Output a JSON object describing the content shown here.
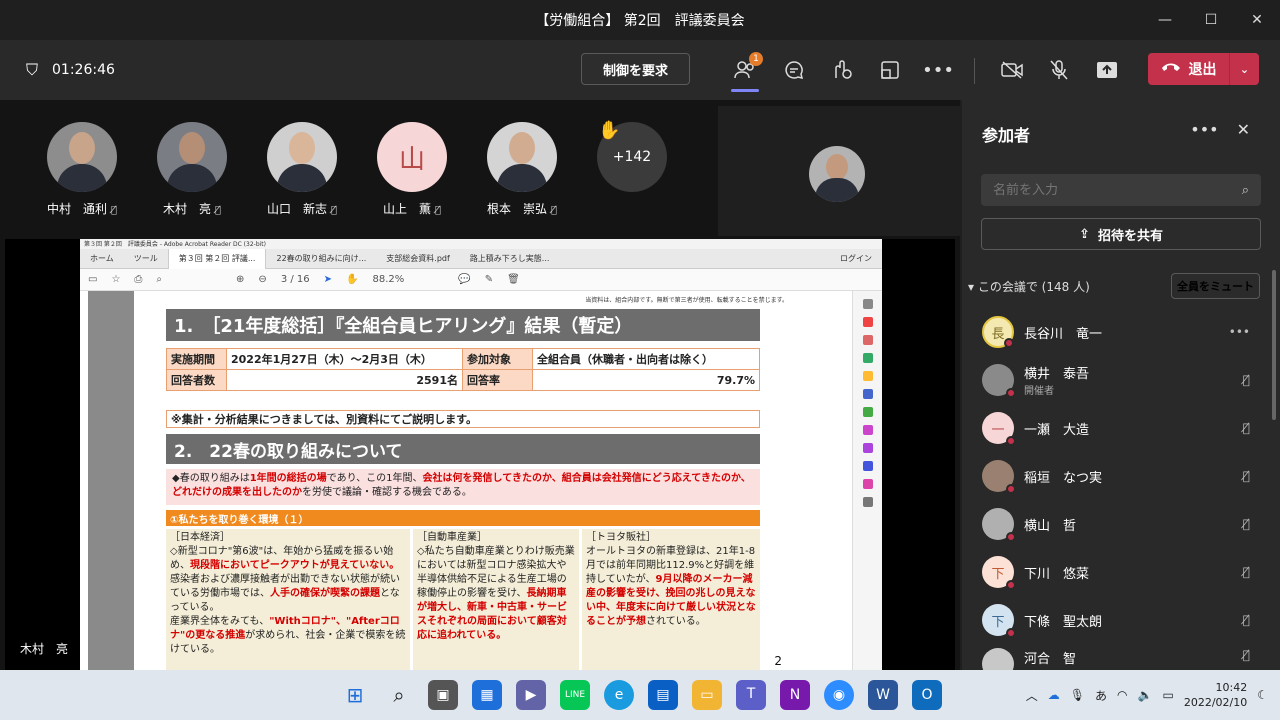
{
  "window": {
    "title": "【労働組合】 第2回　評議委員会"
  },
  "toolbar": {
    "timer": "01:26:46",
    "request_control": "制御を要求",
    "participants_badge": "1",
    "leave_label": "退出"
  },
  "attendees": [
    {
      "name": "中村　通利"
    },
    {
      "name": "木村　亮"
    },
    {
      "name": "山口　新志"
    },
    {
      "name": "山上　薫",
      "initial": "山"
    },
    {
      "name": "根本　崇弘"
    }
  ],
  "more_count": "+142",
  "share": {
    "presenter": "木村　亮"
  },
  "reader": {
    "title": "第３回 第２回　評議委員会 - Adobe Acrobat Reader DC (32-bit)",
    "tabs": [
      "ホーム",
      "ツール",
      "第３回 第２回 評議...",
      "22春の取り組みに向け...",
      "支部総会資料.pdf",
      "路上積み下ろし実態..."
    ],
    "login": "ログイン",
    "page_current": "3",
    "page_total": "/ 16",
    "zoom": "88.2%"
  },
  "doc": {
    "note": "当資料は、組合内部です。無断で第三者が使用、転載することを禁じます。",
    "h1": "1.　［21年度総括］『全組合員ヒアリング』結果（暫定）",
    "info": {
      "period_label": "実施期間",
      "period_value": "2022年1月27日（木）～2月3日（木）",
      "target_label": "参加対象",
      "target_value": "全組合員（休職者・出向者は除く）",
      "count_label": "回答者数",
      "count_value": "2591名",
      "rate_label": "回答率",
      "rate_value": "79.7%"
    },
    "info_note": "※集計・分析結果につきましては、別資料にてご説明します。",
    "h2": "2.　22春の取り組みについて",
    "intro_a": "◆春の取り組みは",
    "intro_b": "1年間の総括の場",
    "intro_c": "であり、この1年間、",
    "intro_d": "会社は何を発信してきたのか、組合員は会社発信にどう応えてきたのか、どれだけの成果を出したのか",
    "intro_e": "を労使で議論・確認する機会である。",
    "sub_h": "①私たちを取り巻く環境（１）",
    "col1": {
      "head": "［日本経済］",
      "t1": "◇新型コロナ\"第6波\"は、年始から猛威を振るい始め、",
      "r1": "現段階においてピークアウトが見えていない。",
      "t2": "感染者および濃厚接触者が出勤できない状態が続いている労働市場では、",
      "r2": "人手の確保が喫緊の課題",
      "t3": "となっている。",
      "t4": "産業界全体をみても、",
      "r3": "\"Withコロナ\"、\"Afterコロナ\"の更なる推進",
      "t5": "が求められ、社会・企業で模索を続けている。"
    },
    "col2": {
      "head": "［自動車産業］",
      "t1": "◇私たち自動車産業とりわけ販売業においては新型コロナ感染拡大や半導体供給不足による生産工場の稼働停止の影響を受け、",
      "r1": "長納期車が増大し、新車・中古車・サービスそれぞれの局面において顧客対応に追われている。"
    },
    "col3": {
      "head": "［トヨタ販社］",
      "t1": "オールトヨタの新車登録は、21年1-8月では前年同期比112.9%と好調を維持していたが、",
      "r1": "9月以降のメーカー減産の影響を受け、挽回の兆しの見えない中、年度末に向けて厳しい状況となることが予想",
      "t2": "されている。"
    },
    "page_num": "2"
  },
  "panel": {
    "title": "参加者",
    "search_placeholder": "名前を入力",
    "invite": "招待を共有",
    "section": "この会議で (148 人)",
    "mute_all": "全員をミュート",
    "people": [
      {
        "name": "長谷川　竜一",
        "initial": "長",
        "role": ""
      },
      {
        "name": "横井　泰吾",
        "initial": "",
        "role": "開催者"
      },
      {
        "name": "一瀬　大造",
        "initial": "一",
        "role": ""
      },
      {
        "name": "稲垣　なつ実",
        "initial": "",
        "role": ""
      },
      {
        "name": "横山　哲",
        "initial": "",
        "role": ""
      },
      {
        "name": "下川　悠菜",
        "initial": "下",
        "role": ""
      },
      {
        "name": "下條　聖太朗",
        "initial": "下",
        "role": ""
      },
      {
        "name": "河合　智",
        "initial": "",
        "role": ""
      }
    ]
  },
  "taskbar": {
    "ime": "あ",
    "time": "10:42",
    "date": "2022/02/10"
  }
}
